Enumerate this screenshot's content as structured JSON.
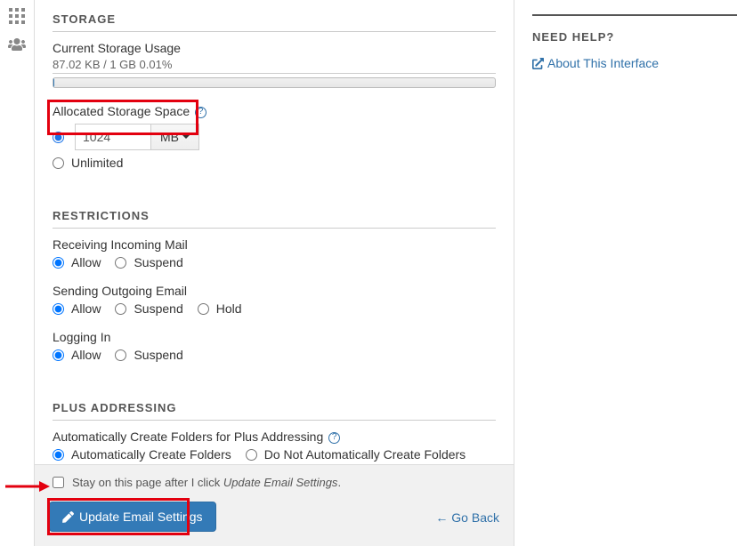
{
  "sections": {
    "storage": {
      "heading": "STORAGE",
      "current_usage_label": "Current Storage Usage",
      "current_usage_text": "87.02 KB / 1 GB 0.01%",
      "allocated_label": "Allocated Storage Space",
      "quota_value": "1024",
      "quota_unit": "MB",
      "unlimited_label": "Unlimited"
    },
    "restrictions": {
      "heading": "RESTRICTIONS",
      "incoming_label": "Receiving Incoming Mail",
      "outgoing_label": "Sending Outgoing Email",
      "login_label": "Logging In",
      "opt_allow": "Allow",
      "opt_suspend": "Suspend",
      "opt_hold": "Hold"
    },
    "plus": {
      "heading": "PLUS ADDRESSING",
      "auto_label": "Automatically Create Folders for Plus Addressing",
      "opt_auto": "Automatically Create Folders",
      "opt_noauto": "Do Not Automatically Create Folders"
    }
  },
  "footer": {
    "stay_prefix": "Stay on this page after I click ",
    "stay_em": "Update Email Settings",
    "stay_suffix": ".",
    "update_btn": "Update Email Settings",
    "go_back": "Go Back"
  },
  "side": {
    "heading": "NEED HELP?",
    "link": "About This Interface"
  }
}
